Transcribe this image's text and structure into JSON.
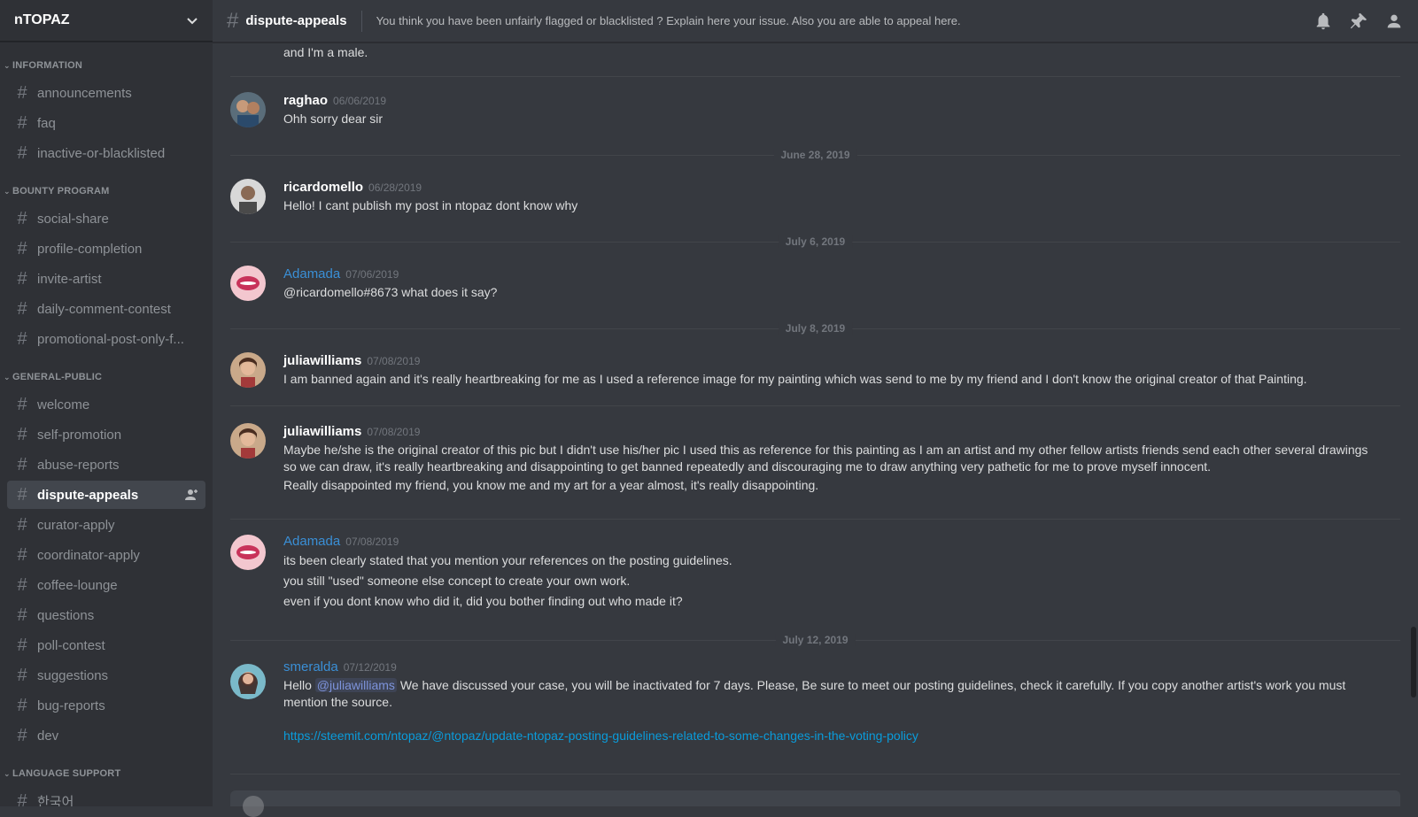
{
  "server": {
    "name": "nTOPAZ"
  },
  "sidebar": {
    "categories": [
      {
        "name": "INFORMATION",
        "channels": [
          "announcements",
          "faq",
          "inactive-or-blacklisted"
        ]
      },
      {
        "name": "BOUNTY PROGRAM",
        "channels": [
          "social-share",
          "profile-completion",
          "invite-artist",
          "daily-comment-contest",
          "promotional-post-only-f..."
        ]
      },
      {
        "name": "GENERAL-PUBLIC",
        "channels": [
          "welcome",
          "self-promotion",
          "abuse-reports",
          "dispute-appeals",
          "curator-apply",
          "coordinator-apply",
          "coffee-lounge",
          "questions",
          "poll-contest",
          "suggestions",
          "bug-reports",
          "dev"
        ]
      },
      {
        "name": "LANGUAGE SUPPORT",
        "channels": [
          "한국어"
        ]
      }
    ],
    "active_channel": "dispute-appeals"
  },
  "header": {
    "channel": "dispute-appeals",
    "topic": "You think you have been unfairly flagged or blacklisted ? Explain here your issue. Also you are able to appeal here.",
    "icons": [
      "bell-icon",
      "pin-icon",
      "members-icon"
    ]
  },
  "messages": {
    "continuation": "and I'm a male.",
    "items": [
      {
        "author": "raghao",
        "color": "#ffffff",
        "timestamp": "06/06/2019",
        "lines": [
          "Ohh sorry dear sir"
        ]
      },
      {
        "author": "ricardomello",
        "color": "#ffffff",
        "timestamp": "06/28/2019",
        "lines": [
          "Hello! I cant publish my post in ntopaz dont know why"
        ]
      },
      {
        "author": "Adamada",
        "color": "#3a8fd6",
        "timestamp": "07/06/2019",
        "lines": [
          "@ricardomello#8673 what does it say?"
        ]
      },
      {
        "author": "juliawilliams",
        "color": "#ffffff",
        "timestamp": "07/08/2019",
        "lines": [
          "I am banned again and it's really heartbreaking for me as I used a reference image for my painting which was send to me by my friend and I don't know the original creator of that Painting."
        ]
      },
      {
        "author": "juliawilliams",
        "color": "#ffffff",
        "timestamp": "07/08/2019",
        "lines": [
          "Maybe he/she is the original creator of this pic but I didn't use his/her pic I used this as reference for this painting as I am an artist and my other fellow artists friends send each other several drawings so we can draw, it's really heartbreaking and disappointing to get banned repeatedly and discouraging me to draw anything very pathetic for me to prove myself innocent.",
          "Really disappointed my friend, you know me and my art for a year almost, it's really disappointing."
        ]
      },
      {
        "author": "Adamada",
        "color": "#3a8fd6",
        "timestamp": "07/08/2019",
        "lines": [
          "its been clearly stated that you mention your references on the posting guidelines.",
          "you still \"used\" someone else concept to create your own work.",
          "even if you dont know who did it, did you bother finding out who made it?"
        ]
      },
      {
        "author": "smeralda",
        "color": "#3a8fd6",
        "timestamp": "07/12/2019",
        "lines_prefix": "Hello",
        "mention": "@juliawilliams",
        "lines_rest": "We have discussed your case, you will be inactivated for 7 days.  Please, Be sure to meet our posting guidelines, check it carefully. If you copy another artist's work you must mention the source.",
        "link": "https://steemit.com/ntopaz/@ntopaz/update-ntopaz-posting-guidelines-related-to-some-changes-in-the-voting-policy"
      }
    ],
    "date_separators": [
      "June 28, 2019",
      "July 6, 2019",
      "July 8, 2019",
      "July 12, 2019"
    ]
  }
}
